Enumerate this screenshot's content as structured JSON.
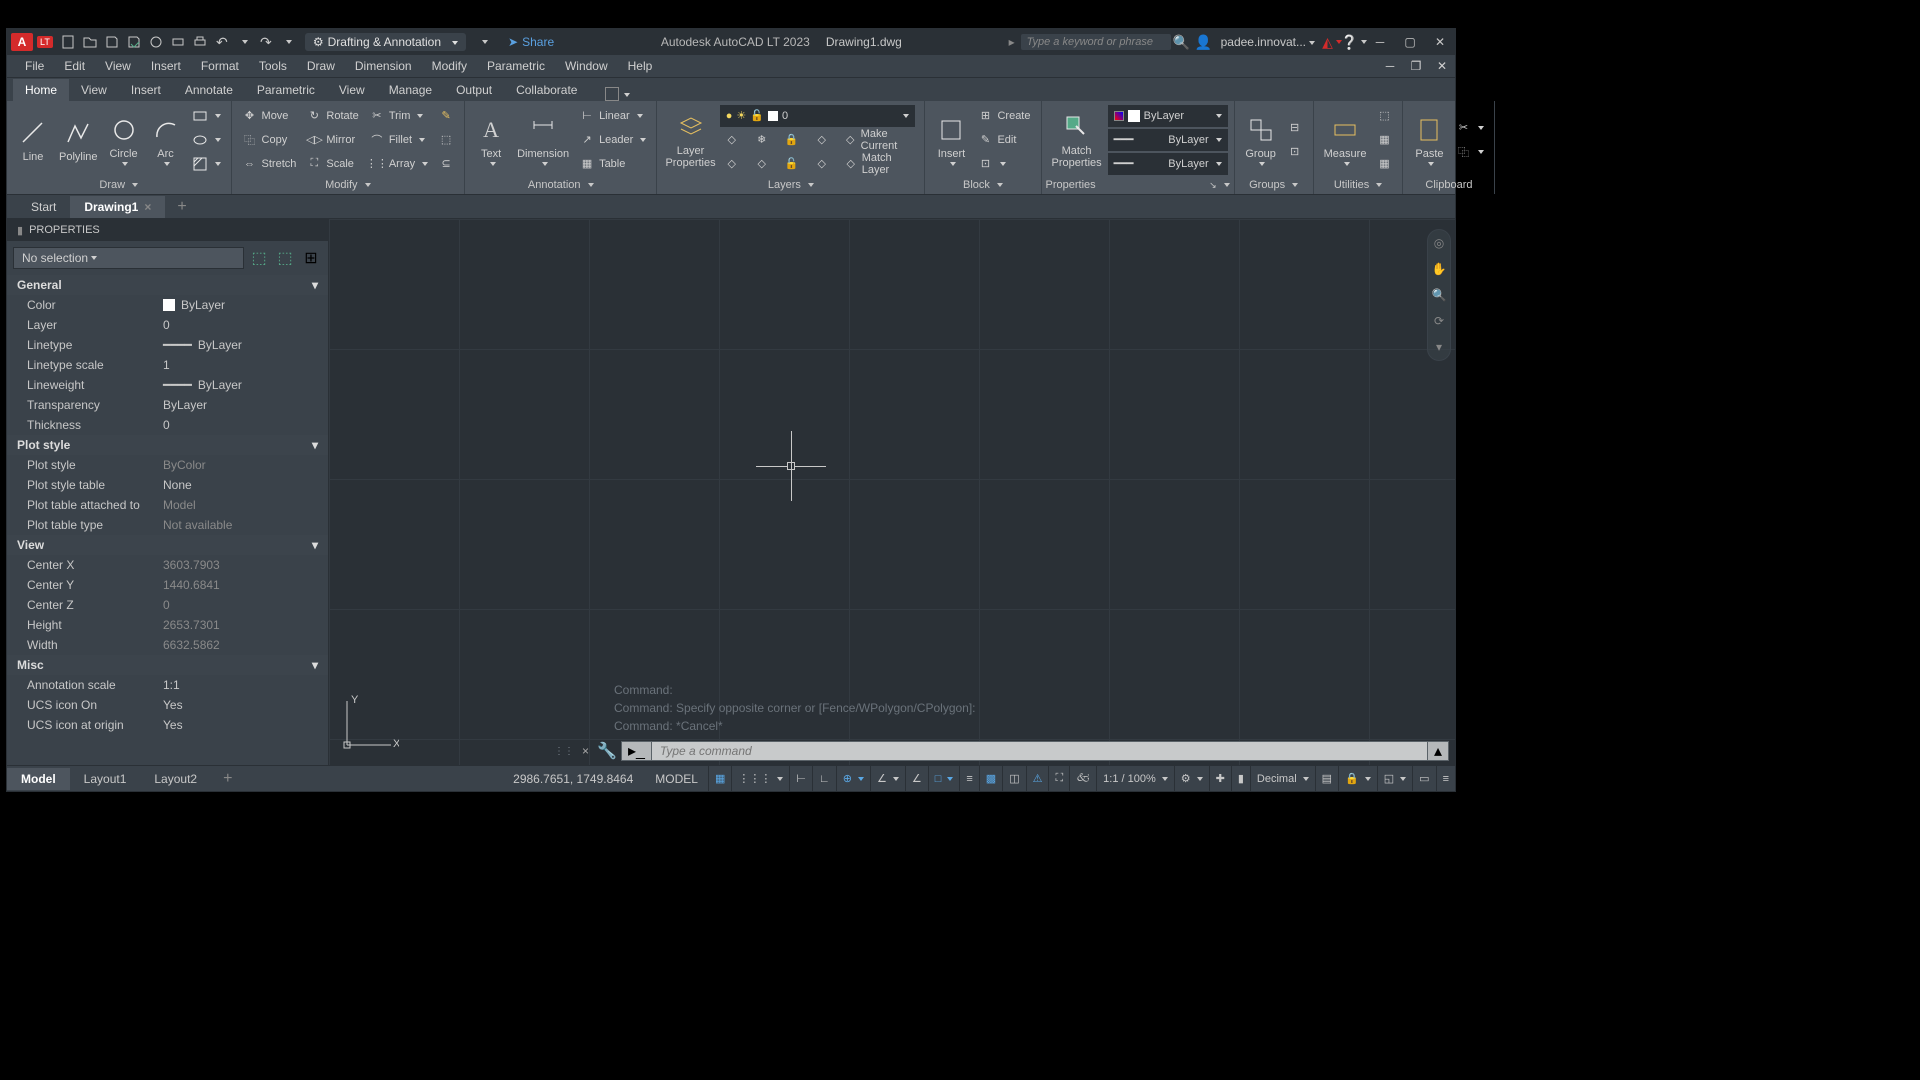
{
  "titlebar": {
    "logo": "A",
    "lt": "LT",
    "workspace": "Drafting & Annotation",
    "share": "Share",
    "app_title": "Autodesk AutoCAD LT 2023",
    "doc_name": "Drawing1.dwg",
    "search_placeholder": "Type a keyword or phrase",
    "user": "padee.innovat..."
  },
  "menubar": [
    "File",
    "Edit",
    "View",
    "Insert",
    "Format",
    "Tools",
    "Draw",
    "Dimension",
    "Modify",
    "Parametric",
    "Window",
    "Help"
  ],
  "ribbon_tabs": [
    "Home",
    "View",
    "Insert",
    "Annotate",
    "Parametric",
    "View",
    "Manage",
    "Output",
    "Collaborate"
  ],
  "ribbon_active": "Home",
  "ribbon": {
    "draw": {
      "title": "Draw",
      "items": [
        "Line",
        "Polyline",
        "Circle",
        "Arc"
      ]
    },
    "modify": {
      "title": "Modify",
      "move": "Move",
      "rotate": "Rotate",
      "trim": "Trim",
      "copy": "Copy",
      "mirror": "Mirror",
      "fillet": "Fillet",
      "stretch": "Stretch",
      "scale": "Scale",
      "array": "Array"
    },
    "annotation": {
      "title": "Annotation",
      "text": "Text",
      "dimension": "Dimension",
      "linear": "Linear",
      "leader": "Leader",
      "table": "Table"
    },
    "layers": {
      "title": "Layers",
      "layer_props": "Layer\nProperties",
      "current": "0",
      "make_current": "Make Current",
      "match": "Match Layer"
    },
    "block": {
      "title": "Block",
      "insert": "Insert",
      "create": "Create",
      "edit": "Edit"
    },
    "properties": {
      "title": "Properties",
      "match": "Match\nProperties",
      "bylayer": "ByLayer"
    },
    "groups": {
      "title": "Groups",
      "group": "Group"
    },
    "utilities": {
      "title": "Utilities",
      "measure": "Measure"
    },
    "clipboard": {
      "title": "Clipboard",
      "paste": "Paste"
    }
  },
  "filetabs": {
    "start": "Start",
    "drawing": "Drawing1"
  },
  "properties": {
    "title": "PROPERTIES",
    "selection": "No selection",
    "general": {
      "hdr": "General",
      "color": {
        "k": "Color",
        "v": "ByLayer"
      },
      "layer": {
        "k": "Layer",
        "v": "0"
      },
      "linetype": {
        "k": "Linetype",
        "v": "ByLayer"
      },
      "ltscale": {
        "k": "Linetype scale",
        "v": "1"
      },
      "lineweight": {
        "k": "Lineweight",
        "v": "ByLayer"
      },
      "transparency": {
        "k": "Transparency",
        "v": "ByLayer"
      },
      "thickness": {
        "k": "Thickness",
        "v": "0"
      }
    },
    "plotstyle": {
      "hdr": "Plot style",
      "style": {
        "k": "Plot style",
        "v": "ByColor"
      },
      "table": {
        "k": "Plot style table",
        "v": "None"
      },
      "attached": {
        "k": "Plot table attached to",
        "v": "Model"
      },
      "type": {
        "k": "Plot table type",
        "v": "Not available"
      }
    },
    "view": {
      "hdr": "View",
      "cx": {
        "k": "Center X",
        "v": "3603.7903"
      },
      "cy": {
        "k": "Center Y",
        "v": "1440.6841"
      },
      "cz": {
        "k": "Center Z",
        "v": "0"
      },
      "h": {
        "k": "Height",
        "v": "2653.7301"
      },
      "w": {
        "k": "Width",
        "v": "6632.5862"
      }
    },
    "misc": {
      "hdr": "Misc",
      "anno": {
        "k": "Annotation scale",
        "v": "1:1"
      },
      "ucson": {
        "k": "UCS icon On",
        "v": "Yes"
      },
      "ucsorigin": {
        "k": "UCS icon at origin",
        "v": "Yes"
      }
    }
  },
  "cmd_history": [
    "Command:",
    "Command: Specify opposite corner or [Fence/WPolygon/CPolygon]:",
    "Command: *Cancel*"
  ],
  "cmd_placeholder": "Type a command",
  "ucs": {
    "x": "X",
    "y": "Y"
  },
  "layout_tabs": [
    "Model",
    "Layout1",
    "Layout2"
  ],
  "status": {
    "coords": "2986.7651, 1749.8464",
    "model": "MODEL",
    "scale": "1:1 / 100%",
    "units": "Decimal"
  }
}
